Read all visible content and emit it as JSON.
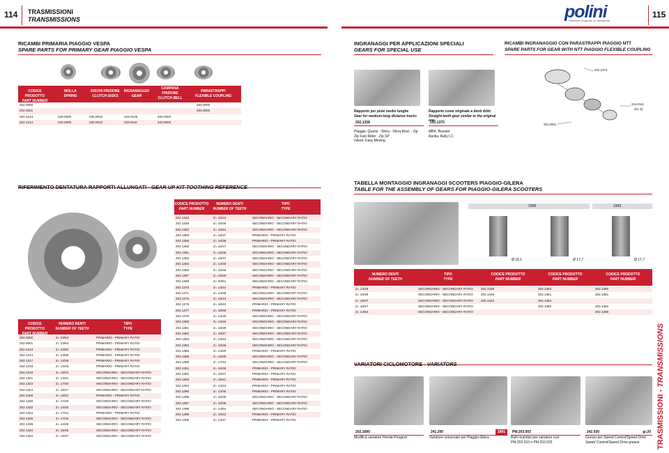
{
  "header": {
    "page_left": "114",
    "page_right": "115",
    "title_it": "TRASMISSIONI",
    "title_en": "TRANSMISSIONS",
    "logo": "polini",
    "tagline": "Passione d'argento in movimento"
  },
  "primary": {
    "title_it": "RICAMBI PRIMARIA PIAGGIO VESPA",
    "title_en": "SPARE PARTS FOR PRIMARY GEAR PIAGGIO VESPA",
    "headers": [
      [
        "CODICE PRODOTTO",
        "PART NUMBER"
      ],
      [
        "MOLLA",
        "SPRING"
      ],
      [
        "DISCHI FRIZIONE",
        "CLUTCH DISKS"
      ],
      [
        "INGRANAGGIO",
        "GEAR"
      ],
      [
        "CAMPANA FRIZIONE",
        "CLUTCH BELL"
      ],
      [
        "PARASTRAPPI",
        "FLEXIBLE COUPLING"
      ]
    ],
    "rows": [
      [
        "202.0000",
        "",
        "",
        "",
        "",
        "334.0000"
      ],
      [
        "202.0001",
        "",
        "",
        "",
        "",
        "334.0000"
      ],
      [
        "202.1213",
        "228.0000",
        "230.0010",
        "229.0105",
        "333.0000",
        ""
      ],
      [
        "202.1214",
        "228.0000",
        "230.0010",
        "229.0110",
        "333.0000",
        ""
      ]
    ]
  },
  "special": {
    "title_it": "INGRANAGGI PER APPLICAZIONI SPECIALI",
    "title_en": "GEARS FOR SPECIAL USE",
    "left_caption_it": "Rapporto per piste medio lunghe",
    "left_caption_en": "Gear for medium-long distance tracks",
    "left_code": "202.1358",
    "right_caption_it": "Rapporto come originale a denti dritti",
    "right_caption_en": "Straight-teeth gear similar to the original one",
    "right_code": "202.1375",
    "left_apps": [
      "Piaggio: Quartz - Sfera - Sfera Rest. - Zip",
      "Zip Fast Rider - Zip SP",
      "Gilera: Easy Moving"
    ],
    "right_apps": [
      "MBK: Booster",
      "Aprilia: Rally LC"
    ]
  },
  "ntt": {
    "title_it": "RICAMBI INGRANAGGIO CON PARASTRAPPI PIAGGIO NTT",
    "title_en": "SPARE PARTS FOR GEAR WITH NTT PIAGGIO FLEXIBLE COUPLING",
    "labels": [
      "202.1373",
      "314.0112",
      "(Gr. 6)",
      "291.0001"
    ]
  },
  "reference": {
    "title_it": "RIFERIMENTO DENTATURA RAPPORTI ALLUNGATI",
    "title_en": "GEAR UP KIT-TOOTHING REFERENCE",
    "headers": [
      [
        "CODICE PRODOTTO",
        "PART NUMBER"
      ],
      [
        "NUMERO DENTI",
        "NUMBER OF TEETH"
      ],
      [
        "TIPO",
        "TYPE"
      ]
    ],
    "left_rows": [
      [
        "202.0000",
        "Z= 23/64",
        "PRIMARIO - PRIMARY RATIO"
      ],
      [
        "202.0001",
        "Z= 23/64",
        "PRIMARIO - PRIMARY RATIO"
      ],
      [
        "202.1213",
        "Z= 23/60",
        "PRIMARIO - PRIMARY RATIO"
      ],
      [
        "202.1214",
        "Z= 24/58",
        "PRIMARIO - PRIMARY RATIO"
      ],
      [
        "202.1317",
        "Z= 13/35",
        "PRIMARIO - PRIMARY RATIO"
      ],
      [
        "202.1318",
        "Z= 14/43",
        "PRIMARIO - PRIMARY RATIO"
      ],
      [
        "202.1319",
        "Z= 18/24",
        "SECONDARIO - SECONDARY RATIO"
      ],
      [
        "202.1321",
        "Z= 14/41",
        "SECONDARIO - SECONDARY RATIO"
      ],
      [
        "202.1323",
        "Z= 17/40",
        "SECONDARIO - SECONDARY RATIO"
      ],
      [
        "202.1324",
        "Z= 16/47",
        "SECONDARIO - SECONDARY RATIO"
      ],
      [
        "202.1328",
        "Z= 16/22",
        "PRIMARIO - PRIMARY RATIO"
      ],
      [
        "202.1330",
        "Z= 17/40",
        "SECONDARIO - SECONDARY RATIO"
      ],
      [
        "202.1332",
        "Z= 14/40",
        "SECONDARIO - SECONDARY RATIO"
      ],
      [
        "202.1334",
        "Z= 17/41",
        "PRIMARIO - PRIMARY RATIO"
      ],
      [
        "202.1336",
        "Z= 17/40",
        "SECONDARIO - SECONDARY RATIO"
      ],
      [
        "202.1338",
        "Z= 14/48",
        "SECONDARIO - SECONDARY RATIO"
      ],
      [
        "202.1340",
        "Z= 15/49",
        "SECONDARIO - SECONDARY RATIO"
      ],
      [
        "202.1342",
        "Z= 16/37",
        "SECONDARIO - SECONDARY RATIO"
      ]
    ],
    "right_rows": [
      [
        "202.1346",
        "Z= 15/42",
        "SECONDARIO - SECONDARY RATIO"
      ],
      [
        "202.1348",
        "Z= 15/39",
        "SECONDARIO - SECONDARY RATIO"
      ],
      [
        "202.1352",
        "Z= 16/44",
        "SECONDARIO - SECONDARY RATIO"
      ],
      [
        "202.1356",
        "Z= 16/37",
        "PRIMARIO - PRIMARY RATIO"
      ],
      [
        "202.1358",
        "Z= 15/38",
        "PRIMARIO - PRIMARY RATIO"
      ],
      [
        "202.1360",
        "Z= 16/47",
        "SECONDARIO - SECONDARY RATIO"
      ],
      [
        "202.1361",
        "Z= 15/39",
        "SECONDARIO - SECONDARY RATIO"
      ],
      [
        "202.1362",
        "Z= 16/37",
        "SECONDARIO - SECONDARY RATIO"
      ],
      [
        "202.1363",
        "Z= 14/48",
        "SECONDARIO - SECONDARY RATIO"
      ],
      [
        "202.1366",
        "Z= 15/48",
        "SECONDARIO - SECONDARY RATIO"
      ],
      [
        "202.1367",
        "Z= 15/49",
        "SECONDARIO - SECONDARY RATIO"
      ],
      [
        "202.1369",
        "Z= 20/61",
        "SECONDARIO - SECONDARY RATIO"
      ],
      [
        "202.1370",
        "Z= 13/44",
        "PRIMARIO - PRIMARY RATIO"
      ],
      [
        "202.1371",
        "Z= 14/48",
        "SECONDARIO - SECONDARY RATIO"
      ],
      [
        "202.1375",
        "Z= 16/44",
        "SECONDARIO - SECONDARY RATIO"
      ],
      [
        "202.1376",
        "Z= 18/43",
        "PRIMARIO - PRIMARY RATIO"
      ],
      [
        "202.1377",
        "Z= 18/69",
        "PRIMARIO - PRIMARY RATIO"
      ],
      [
        "202.1378",
        "Z= 14/48",
        "SECONDARIO - SECONDARY RATIO"
      ],
      [
        "202.1380",
        "Z= 14/48",
        "SECONDARIO - SECONDARY RATIO"
      ],
      [
        "202.1381",
        "Z= 15/39",
        "SECONDARIO - SECONDARY RATIO"
      ],
      [
        "202.1382",
        "Z= 16/47",
        "SECONDARIO - SECONDARY RATIO"
      ],
      [
        "202.1383",
        "Z= 13/43",
        "SECONDARIO - SECONDARY RATIO"
      ],
      [
        "202.1384",
        "Z= 16/36",
        "SECONDARIO - SECONDARY RATIO"
      ],
      [
        "202.1386",
        "Z= 14/29",
        "PRIMARIO - PRIMARY RATIO"
      ],
      [
        "202.1388",
        "Z= 15/36",
        "SECONDARIO - SECONDARY RATIO"
      ],
      [
        "202.1389",
        "Z= 17/44",
        "SECONDARIO - SECONDARY RATIO"
      ],
      [
        "202.1391",
        "Z= 16/46",
        "PRIMARIO - PRIMARY RATIO"
      ],
      [
        "202.1392",
        "Z= 16/37",
        "PRIMARIO - PRIMARY RATIO"
      ],
      [
        "202.1393",
        "Z= 15/41",
        "PRIMARIO - PRIMARY RATIO"
      ],
      [
        "202.1394",
        "Z= 14/43",
        "PRIMARIO - PRIMARY RATIO"
      ],
      [
        "202.1395",
        "Z= 13/35",
        "PRIMARIO - PRIMARY RATIO"
      ],
      [
        "202.1396",
        "Z= 15/39",
        "SECONDARIO - SECONDARY RATIO"
      ],
      [
        "202.1397",
        "Z= 16/38",
        "SECONDARIO - SECONDARY RATIO"
      ],
      [
        "202.1398",
        "Z= 14/54",
        "SECONDARIO - SECONDARY RATIO"
      ],
      [
        "202.1399",
        "Z= 16/42",
        "PRIMARIO - PRIMARY RATIO"
      ],
      [
        "202.1400",
        "Z= 14/47",
        "PRIMARIO - PRIMARY RATIO"
      ]
    ]
  },
  "assembly": {
    "title_it": "TABELLA MONTAGGIO INGRANAGGI SCOOTERS PIAGGIO-GILERA",
    "title_en": "TABLE FOR THE ASSEMBLY OF GEARS FOR PIAGGIO-GILERA SCOOTERS",
    "year_a": "1998",
    "year_b": "1999",
    "diameters": [
      "Ø 18,1",
      "Ø 17,7",
      "Ø 17,7"
    ],
    "headers": [
      [
        "NUMERO DENTI",
        "NUMBER OF TEETH"
      ],
      [
        "TIPO",
        "TYPE"
      ],
      [
        "CODICE PRODOTTO",
        "PART NUMBER"
      ],
      [
        "CODICE PRODOTTO",
        "PART NUMBER"
      ],
      [
        "CODICE PRODOTTO",
        "PART NUMBER"
      ]
    ],
    "rows": [
      [
        "Z= 14/48",
        "SECONDARIO - SECONDARY RATIO",
        "202.1338",
        "202.1363",
        "202.1380"
      ],
      [
        "Z= 15/39",
        "SECONDARIO - SECONDARY RATIO",
        "202.1348",
        "202.1361",
        "202.1381"
      ],
      [
        "Z= 16/37",
        "SECONDARIO - SECONDARY RATIO",
        "202.1342",
        "202.1362",
        ""
      ],
      [
        "Z= 16/47",
        "SECONDARIO - SECONDARY RATIO",
        "",
        "202.1360",
        "202.1382"
      ],
      [
        "Z= 14/54",
        "SECONDARIO - SECONDARY RATIO",
        "",
        "",
        "202.1398"
      ]
    ]
  },
  "variators": {
    "title_it": "VARIATORI CICLOMOTORE",
    "title_en": "VARIATORS",
    "items": [
      {
        "code": "202.1690",
        "tag": "",
        "desc": [
          "Modifica variatore Honda-Peugeot"
        ]
      },
      {
        "code": "241.200",
        "tag": "1991",
        "desc": [
          "Variatore universale per Piaggio-Gilera"
        ]
      },
      {
        "code": "PM.203.003",
        "tag": "",
        "desc": [
          "Rulli ricambio per variatore cod.",
          "PM.202.010 e PM.202.025"
        ]
      },
      {
        "code": "242.030",
        "tag": "gr.20",
        "desc": [
          "Grasso per Speed Control/Speed Drive",
          "Speed Control/Speed Drive grease"
        ]
      }
    ]
  },
  "side_tab": {
    "label_it": "TRASMISSIONI",
    "label_en": "TRANSMISSIONS"
  },
  "colors": {
    "accent": "#c8202f",
    "band": "#c8202f"
  }
}
